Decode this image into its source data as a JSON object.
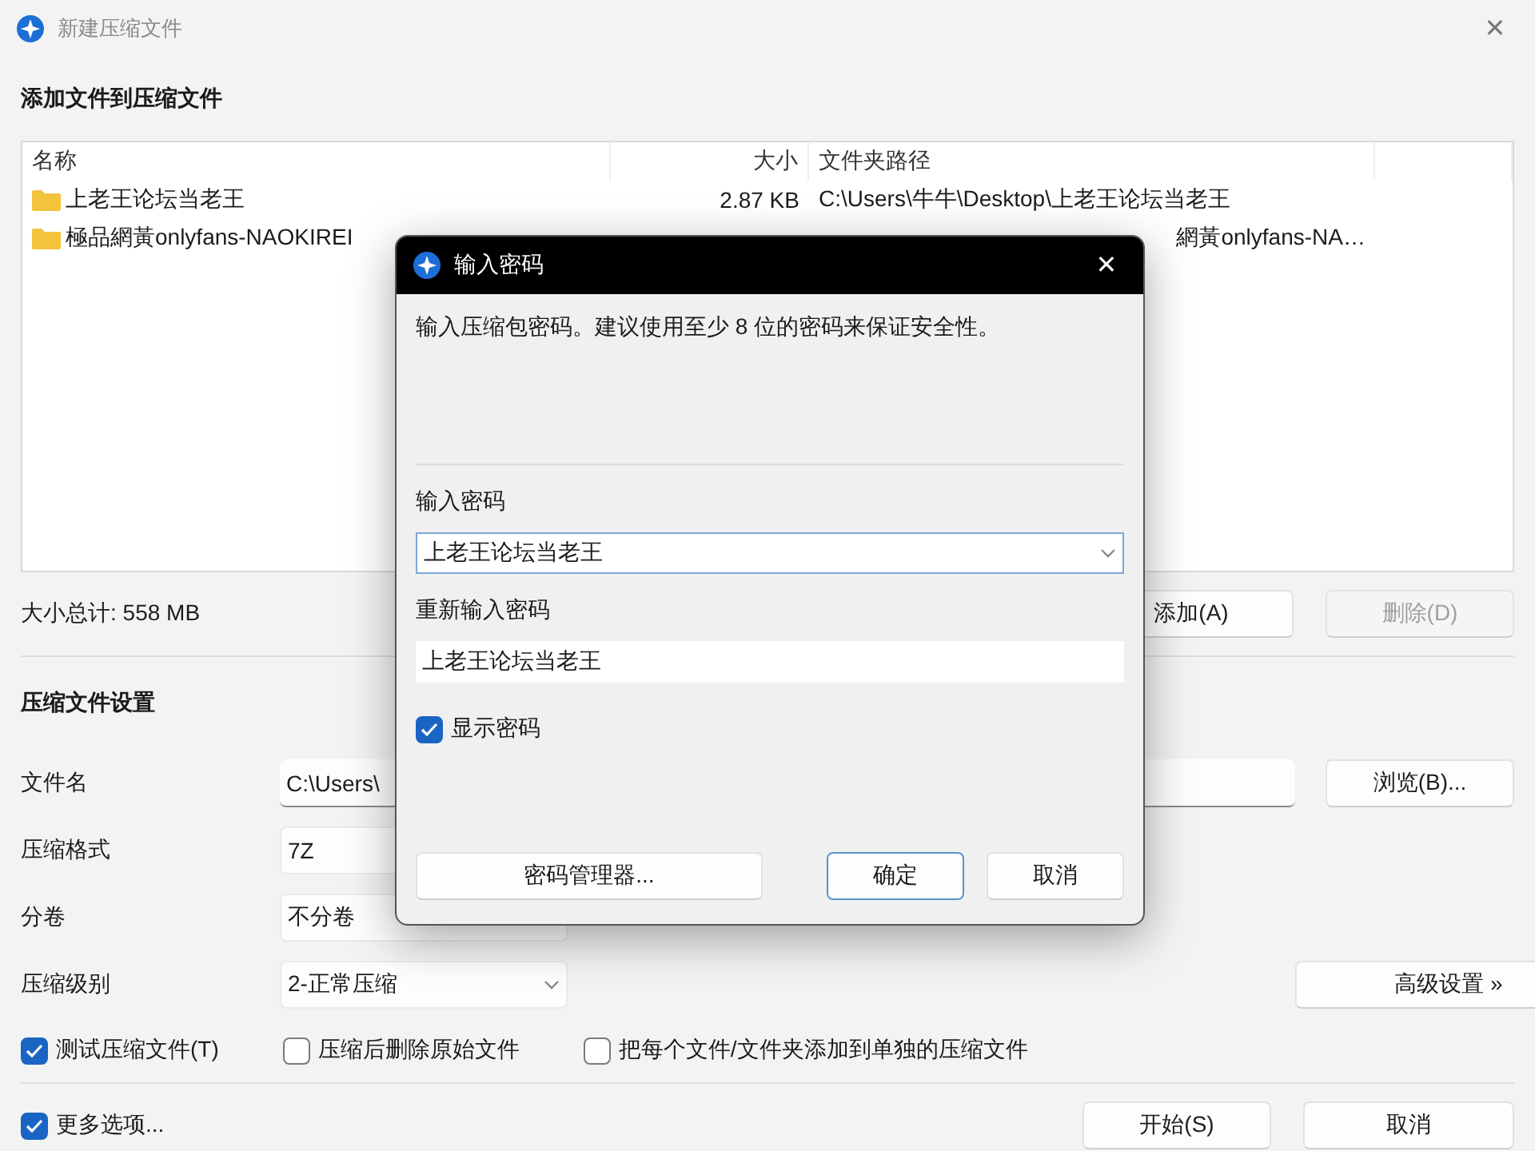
{
  "window": {
    "title": "新建压缩文件",
    "active": false,
    "close": "✕"
  },
  "files_section": {
    "heading": "添加文件到压缩文件",
    "columns": [
      "名称",
      "大小",
      "文件夹路径"
    ],
    "rows": [
      {
        "name": "上老王论坛当老王",
        "size": "2.87 KB",
        "path": "C:\\Users\\牛牛\\Desktop\\上老王论坛当老王",
        "partly_covered": false
      },
      {
        "name": "極品網黃onlyfans-NAOKIREI",
        "path": "網黃onlyfans-NA…",
        "partly_covered": true
      }
    ],
    "total": "大小总计: 558 MB",
    "buttons": [
      {
        "label": "添加(A)",
        "disabled": false
      },
      {
        "label": "删除(D)",
        "disabled": true
      }
    ]
  },
  "settings_section": {
    "heading": "压缩文件设置",
    "fields": [
      {
        "label": "文件名",
        "kind": "text",
        "value": "C:\\Users\\",
        "button": "浏览(B)..."
      },
      {
        "label": "压缩格式",
        "kind": "dropdown",
        "value": "7Z"
      },
      {
        "label": "分卷",
        "kind": "dropdown",
        "value": "不分卷"
      },
      {
        "label": "压缩级别",
        "kind": "dropdown",
        "value": "2-正常压缩",
        "arrow_visible": true,
        "button": "高级设置 »"
      }
    ],
    "options": [
      {
        "label": "测试压缩文件(T)",
        "checked": true
      },
      {
        "label": "压缩后删除原始文件",
        "checked": false
      },
      {
        "label": "把每个文件/文件夹添加到单独的压缩文件",
        "checked": false
      }
    ]
  },
  "footer": {
    "more_options": {
      "label": "更多选项...",
      "checked": true
    },
    "buttons": [
      {
        "label": "开始(S)"
      },
      {
        "label": "取消"
      }
    ]
  },
  "dialog": {
    "title": "输入密码",
    "close": "✕",
    "description": "输入压缩包密码。建议使用至少 8 位的密码来保证安全性。",
    "password_label": "输入密码",
    "password": "上老王论坛当老王",
    "repeat_label": "重新输入密码",
    "repeat": "上老王论坛当老王",
    "show_password": {
      "label": "显示密码",
      "checked": true
    },
    "buttons": [
      {
        "label": "密码管理器...",
        "default": false
      },
      {
        "label": "确定",
        "default": true
      },
      {
        "label": "取消",
        "default": false
      }
    ]
  }
}
